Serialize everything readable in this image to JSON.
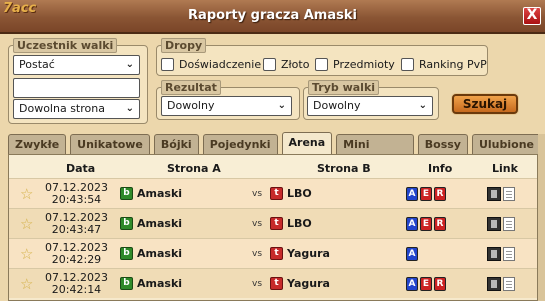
{
  "window": {
    "title": "Raporty gracza Amaski",
    "close_label": "X",
    "corner_text": "7acc"
  },
  "filters": {
    "participant": {
      "legend": "Uczestnik walki",
      "select_value": "Postać",
      "input_value": "",
      "side_select": "Dowolna strona"
    },
    "loot": {
      "legend": "Dropy",
      "options": [
        "Doświadczenie",
        "Złoto",
        "Przedmioty",
        "Ranking PvP"
      ]
    },
    "result": {
      "legend": "Rezultat",
      "value": "Dowolny"
    },
    "mode": {
      "legend": "Tryb walki",
      "value": "Dowolny"
    },
    "search_label": "Szukaj"
  },
  "tabs": [
    "Zwykłe",
    "Unikatowe",
    "Bójki",
    "Pojedynki",
    "Arena",
    "Mini bossy",
    "Bossy",
    "Ulubione"
  ],
  "active_tab": "Arena",
  "table": {
    "headers": {
      "date": "Data",
      "side_a": "Strona A",
      "side_b": "Strona B",
      "info": "Info",
      "link": "Link"
    },
    "vs_label": "vs",
    "rows": [
      {
        "date": "07.12.2023",
        "time": "20:43:54",
        "a": "Amaski",
        "b": "LBO",
        "info": [
          "A",
          "E",
          "R"
        ]
      },
      {
        "date": "07.12.2023",
        "time": "20:43:47",
        "a": "Amaski",
        "b": "LBO",
        "info": [
          "A",
          "E",
          "R"
        ]
      },
      {
        "date": "07.12.2023",
        "time": "20:42:29",
        "a": "Amaski",
        "b": "Yagura",
        "info": [
          "A"
        ]
      },
      {
        "date": "07.12.2023",
        "time": "20:42:14",
        "a": "Amaski",
        "b": "Yagura",
        "info": [
          "A",
          "E",
          "R"
        ]
      }
    ]
  },
  "colors": {
    "accent": "#c66a1e",
    "title_bar": "#8a5534",
    "side_a": "#2f8a2a",
    "side_b": "#c62a2a"
  }
}
